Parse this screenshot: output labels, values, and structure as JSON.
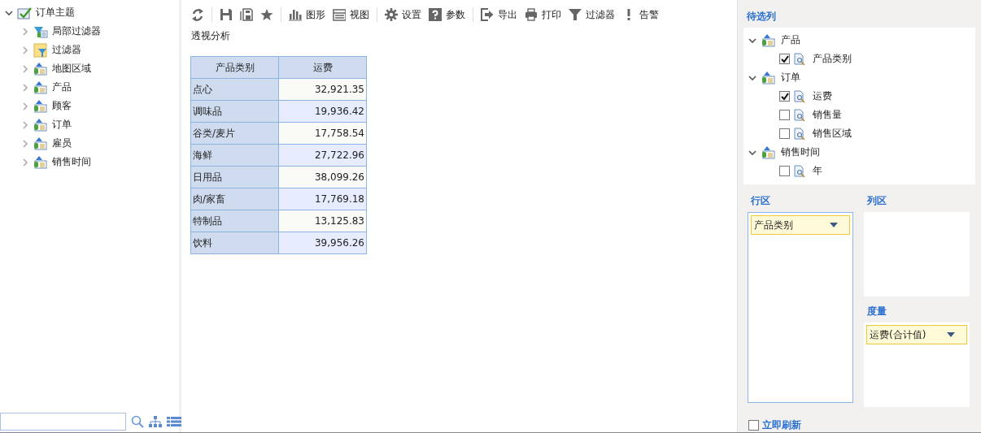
{
  "left_tree": {
    "label": "订单主题",
    "kind": "subject",
    "expanded": true,
    "children": [
      {
        "label": "局部过滤器",
        "kind": "local-filter",
        "expanded": false
      },
      {
        "label": "过滤器",
        "kind": "filter",
        "expanded": false
      },
      {
        "label": "地图区域",
        "kind": "dimension",
        "expanded": false
      },
      {
        "label": "产品",
        "kind": "dimension",
        "expanded": false
      },
      {
        "label": "顾客",
        "kind": "dimension",
        "expanded": false
      },
      {
        "label": "订单",
        "kind": "dimension",
        "expanded": false
      },
      {
        "label": "雇员",
        "kind": "dimension",
        "expanded": false
      },
      {
        "label": "销售时间",
        "kind": "dimension",
        "expanded": false
      }
    ]
  },
  "toolbar": [
    {
      "kind": "refresh"
    },
    {
      "kind": "separator"
    },
    {
      "kind": "save"
    },
    {
      "kind": "save-as"
    },
    {
      "kind": "star"
    },
    {
      "kind": "separator"
    },
    {
      "kind": "chart",
      "label": "图形"
    },
    {
      "kind": "view",
      "label": "视图"
    },
    {
      "kind": "separator"
    },
    {
      "kind": "settings",
      "label": "设置"
    },
    {
      "kind": "help",
      "label": "参数"
    },
    {
      "kind": "separator"
    },
    {
      "kind": "export",
      "label": "导出"
    },
    {
      "kind": "print",
      "label": "打印"
    },
    {
      "kind": "filter",
      "label": "过滤器"
    },
    {
      "kind": "alert",
      "label": "告警"
    }
  ],
  "report_title": "透视分析",
  "table": {
    "columns": [
      "产品类别",
      "运费"
    ],
    "rows": [
      [
        "点心",
        "32,921.35"
      ],
      [
        "调味品",
        "19,936.42"
      ],
      [
        "谷类/麦片",
        "17,758.54"
      ],
      [
        "海鲜",
        "27,722.96"
      ],
      [
        "日用品",
        "38,099.26"
      ],
      [
        "肉/家畜",
        "17,769.18"
      ],
      [
        "特制品",
        "13,125.83"
      ],
      [
        "饮料",
        "39,956.26"
      ]
    ]
  },
  "candidates": {
    "title": "待选列",
    "groups": [
      {
        "label": "产品",
        "expanded": true,
        "fields": [
          {
            "label": "产品类别",
            "checked": true
          }
        ]
      },
      {
        "label": "订单",
        "expanded": true,
        "fields": [
          {
            "label": "运费",
            "checked": true
          },
          {
            "label": "销售量",
            "checked": false
          },
          {
            "label": "销售区域",
            "checked": false
          }
        ]
      },
      {
        "label": "销售时间",
        "expanded": true,
        "fields": [
          {
            "label": "年",
            "checked": false
          }
        ]
      }
    ]
  },
  "row_area": {
    "title": "行区",
    "items": [
      "产品类别"
    ]
  },
  "column_area": {
    "title": "列区"
  },
  "measure_area": {
    "title": "度量",
    "items": [
      "运费(合计值)"
    ]
  },
  "auto_refresh": {
    "label": "立即刷新",
    "checked": false
  }
}
